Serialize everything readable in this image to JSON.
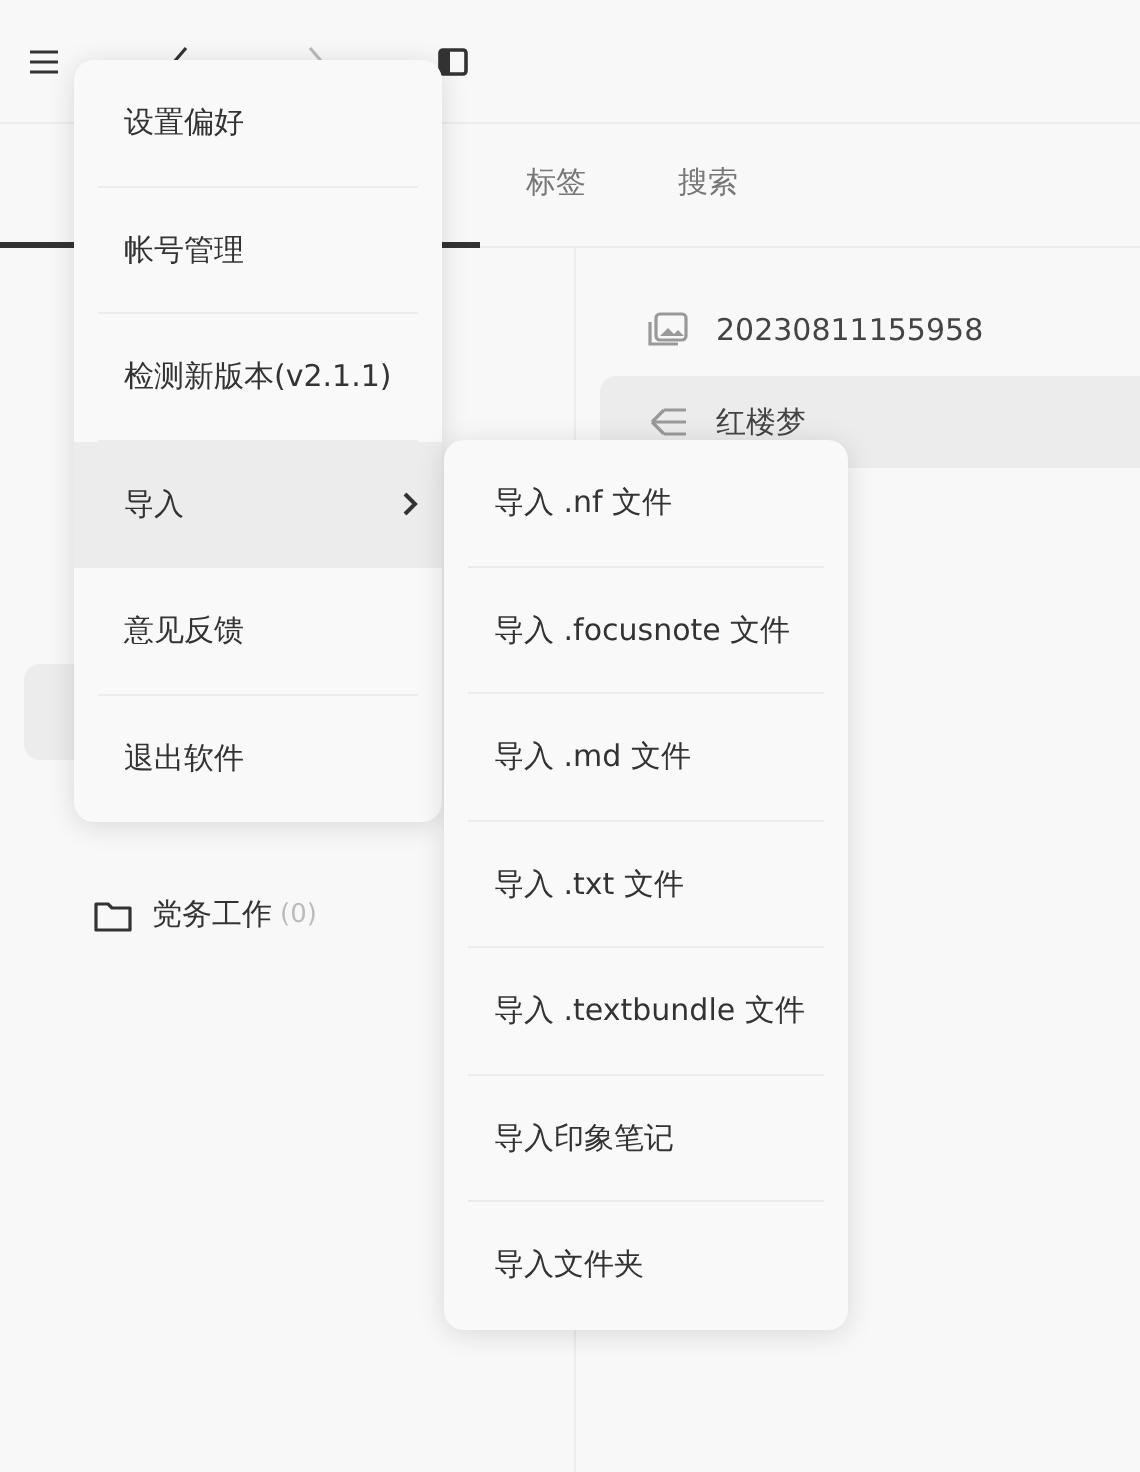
{
  "tabs": [
    {
      "label": "标签",
      "selected": false
    },
    {
      "label": "搜索",
      "selected": false
    }
  ],
  "folders": [
    {
      "name": "党务工作",
      "count": "(0)"
    }
  ],
  "notes": [
    {
      "title": "20230811155958",
      "kind": "image",
      "selected": false
    },
    {
      "title": "红楼梦",
      "kind": "text",
      "selected": true
    }
  ],
  "menu": {
    "items": [
      {
        "label": "设置偏好",
        "has_submenu": false,
        "selected": false
      },
      {
        "label": "帐号管理",
        "has_submenu": false,
        "selected": false
      },
      {
        "label": "检测新版本(v2.1.1)",
        "has_submenu": false,
        "selected": false
      },
      {
        "label": "导入",
        "has_submenu": true,
        "selected": true
      },
      {
        "label": "意见反馈",
        "has_submenu": false,
        "selected": false
      },
      {
        "label": "退出软件",
        "has_submenu": false,
        "selected": false
      }
    ]
  },
  "submenu": {
    "items": [
      {
        "label": "导入 .nf 文件"
      },
      {
        "label": "导入 .focusnote 文件"
      },
      {
        "label": "导入 .md 文件"
      },
      {
        "label": "导入 .txt 文件"
      },
      {
        "label": "导入 .textbundle 文件"
      },
      {
        "label": "导入印象笔记"
      },
      {
        "label": "导入文件夹"
      }
    ]
  }
}
